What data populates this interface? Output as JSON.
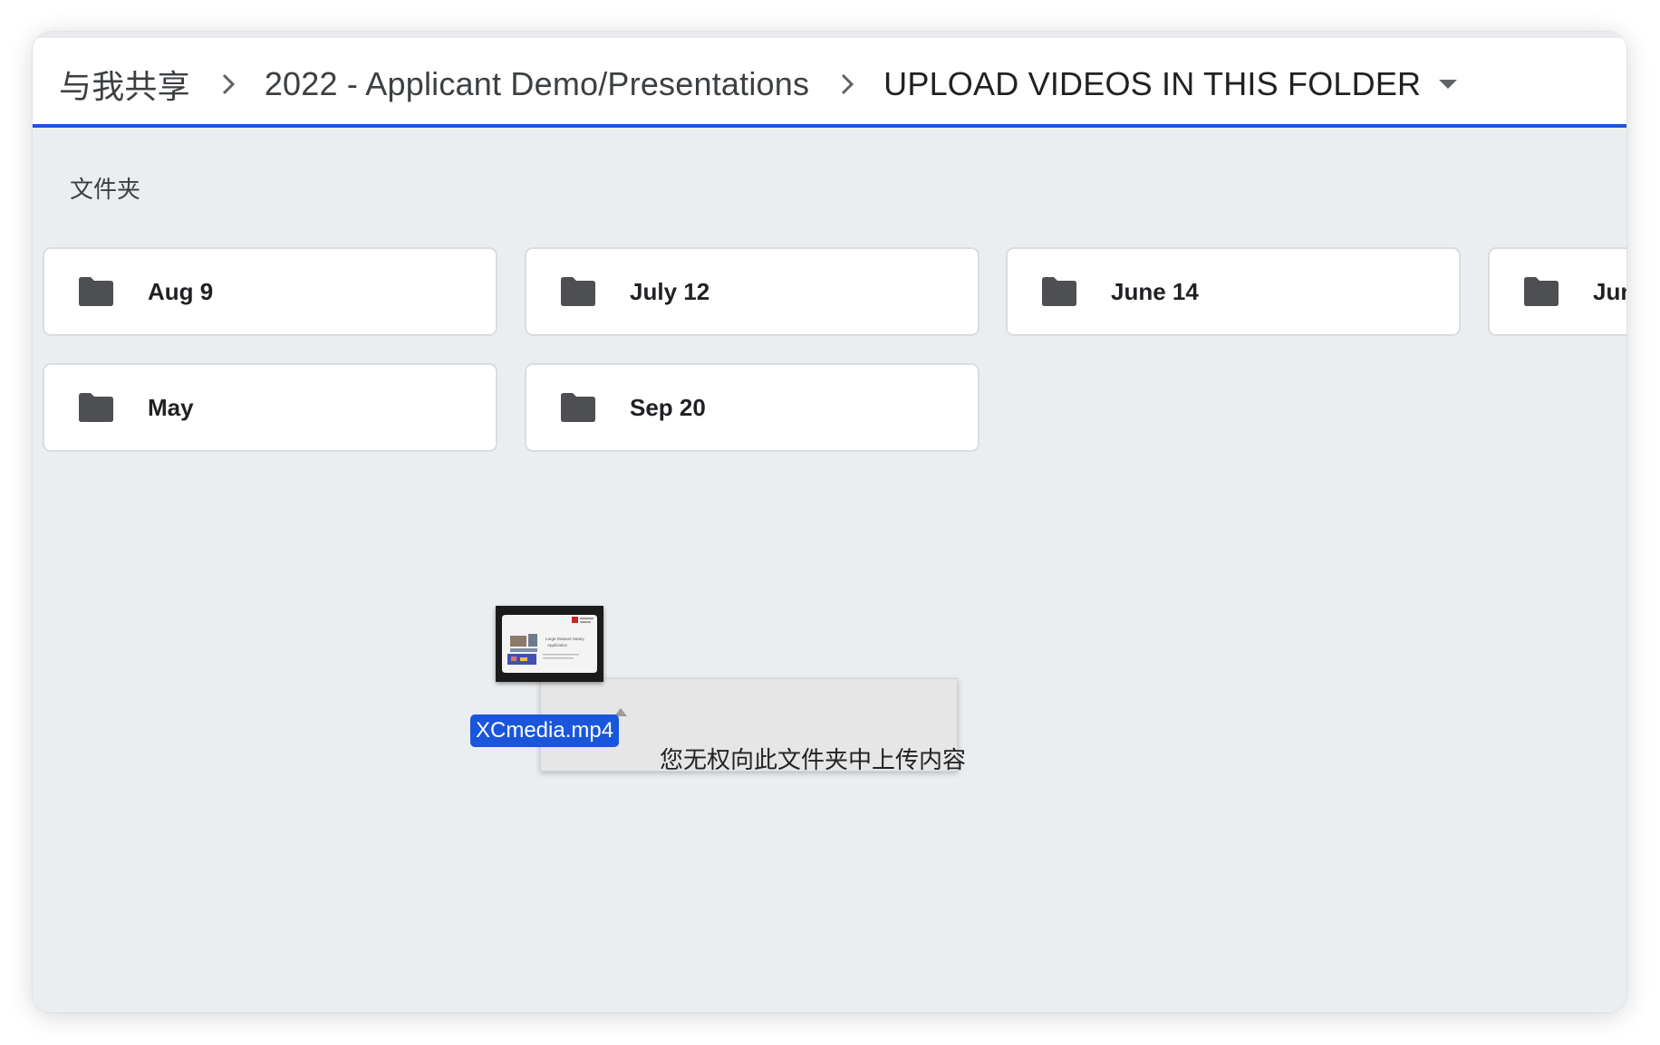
{
  "breadcrumb": {
    "root": "与我共享",
    "parent": "2022 - Applicant Demo/Presentations",
    "current": "UPLOAD VIDEOS IN THIS FOLDER"
  },
  "icons": {
    "separator": "chevron-right-icon",
    "dropdown": "caret-down-icon",
    "folder": "folder-icon"
  },
  "section": {
    "label": "文件夹"
  },
  "folders": [
    {
      "name": "Aug 9"
    },
    {
      "name": "July 12"
    },
    {
      "name": "June 14"
    },
    {
      "name": "Jun"
    },
    {
      "name": "May"
    },
    {
      "name": "Sep 20"
    }
  ],
  "drag": {
    "filename": "XCmedia.mp4",
    "tooltip": "您无权向此文件夹中上传内容",
    "thumbnail_text": [
      "Large Dataset Notary",
      "Application"
    ]
  },
  "colors": {
    "accent": "#1a56db",
    "background": "#ebeef0",
    "folder_icon": "#4d4f53"
  }
}
